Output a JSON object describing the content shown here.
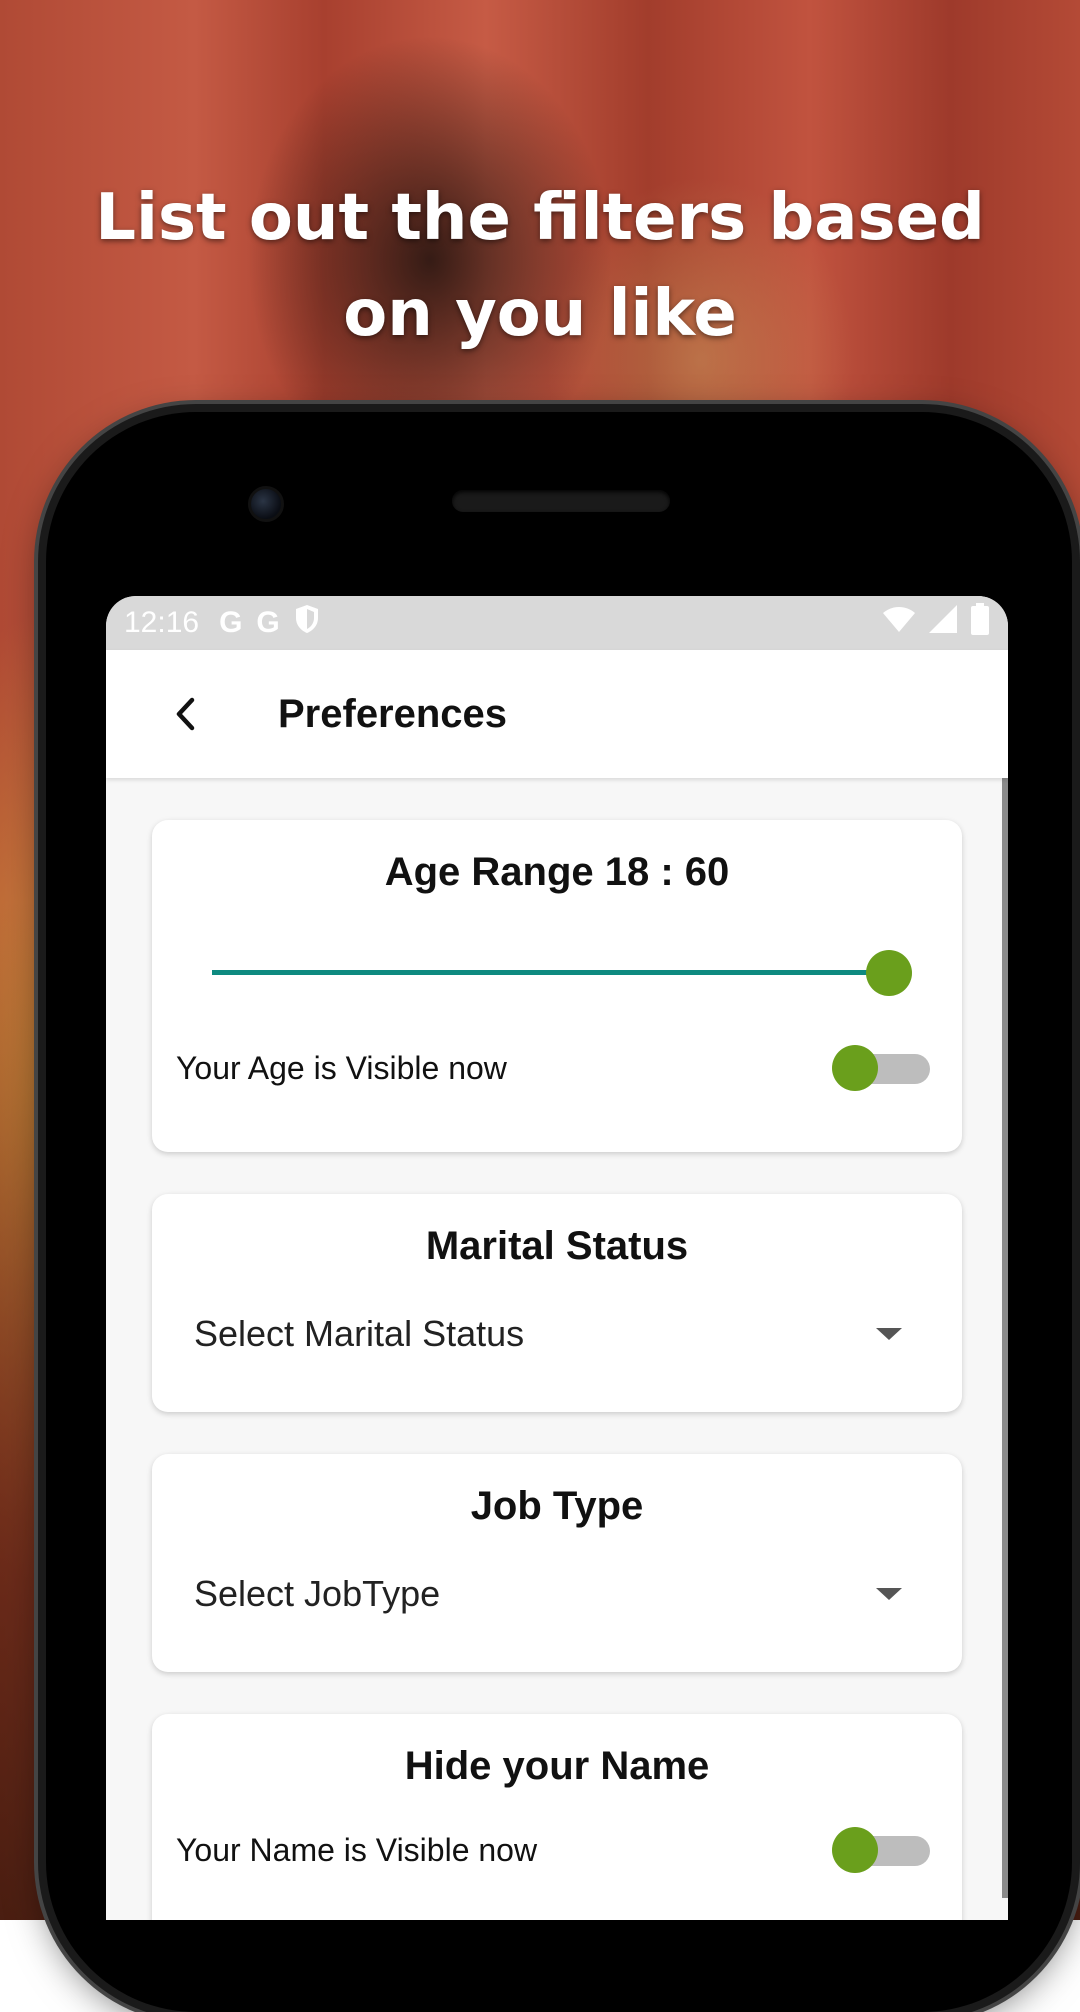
{
  "headline": "List out the filters based on you like",
  "status_bar": {
    "time": "12:16",
    "icons": [
      "google-icon",
      "google-icon",
      "shield-icon",
      "wifi-icon",
      "signal-icon",
      "battery-icon"
    ]
  },
  "app_bar": {
    "title": "Preferences",
    "back_icon": "chevron-left-icon"
  },
  "age_card": {
    "title": "Age Range 18 : 60",
    "slider_value": 1.0,
    "visibility_label": "Your Age is Visible now",
    "toggle_on": false
  },
  "marital_card": {
    "title": "Marital Status",
    "select_value": "Select Marital Status"
  },
  "job_card": {
    "title": "Job Type",
    "select_value": "Select JobType"
  },
  "hide_name_card": {
    "title": "Hide your Name",
    "visibility_label": "Your Name is Visible now",
    "toggle_on": false
  },
  "colors": {
    "accent_green": "#6a9f1c",
    "slider_track": "#0e8a80",
    "status_bar_bg": "#d9d9d9"
  }
}
